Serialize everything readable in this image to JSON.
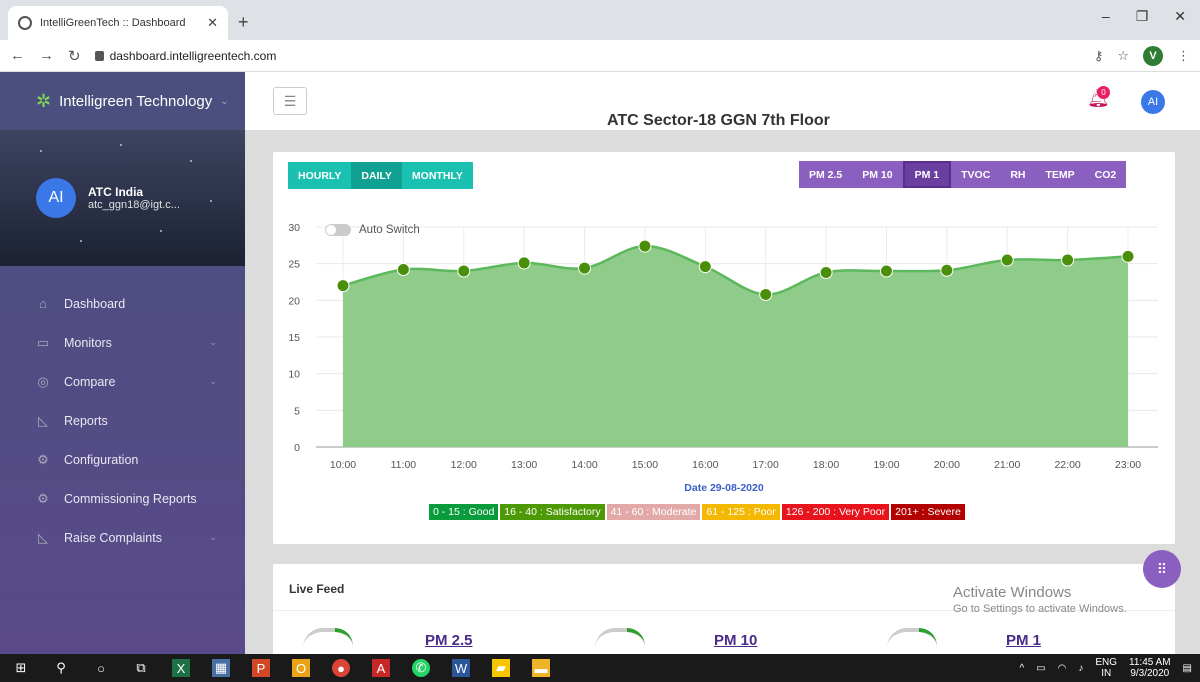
{
  "browser": {
    "tab_title": "IntelliGreenTech :: Dashboard",
    "tab_close": "✕",
    "new_tab": "+",
    "url": "dashboard.intelligreentech.com",
    "profile_initial": "V"
  },
  "sidebar": {
    "brand": "Intelligreen Technology",
    "user_initials": "AI",
    "user_name": "ATC India",
    "user_email": "atc_ggn18@igt.c...",
    "items": [
      {
        "label": "Dashboard",
        "icon": "home-icon",
        "caret": false
      },
      {
        "label": "Monitors",
        "icon": "monitor-icon",
        "caret": true
      },
      {
        "label": "Compare",
        "icon": "compare-icon",
        "caret": true
      },
      {
        "label": "Reports",
        "icon": "reports-icon",
        "caret": false
      },
      {
        "label": "Configuration",
        "icon": "config-icon",
        "caret": false
      },
      {
        "label": "Commissioning Reports",
        "icon": "commissioning-icon",
        "caret": false
      },
      {
        "label": "Raise Complaints",
        "icon": "complaints-icon",
        "caret": true
      }
    ]
  },
  "header": {
    "title": "ATC Sector-18 GGN 7th Floor",
    "notification_count": "0",
    "avatar_initials": "AI"
  },
  "time_buttons": [
    "HOURLY",
    "DAILY",
    "MONTHLY"
  ],
  "time_active": "DAILY",
  "param_buttons": [
    "PM 2.5",
    "PM 10",
    "PM 1",
    "TVOC",
    "RH",
    "TEMP",
    "CO2"
  ],
  "param_active": "PM 1",
  "auto_switch_label": "Auto Switch",
  "date_label": "Date 29-08-2020",
  "legend": [
    {
      "label": "0 - 15 : Good",
      "color": "#0a9b3c"
    },
    {
      "label": "16 - 40 : Satisfactory",
      "color": "#4e9a06"
    },
    {
      "label": "41 - 60 : Moderate",
      "color": "#e3a9a9"
    },
    {
      "label": "61 - 125 : Poor",
      "color": "#f5b800"
    },
    {
      "label": "126 - 200 : Very Poor",
      "color": "#e8141d"
    },
    {
      "label": "201+ : Severe",
      "color": "#b30000"
    }
  ],
  "chart_data": {
    "type": "area",
    "x": [
      "10:00",
      "11:00",
      "12:00",
      "13:00",
      "14:00",
      "15:00",
      "16:00",
      "17:00",
      "18:00",
      "19:00",
      "20:00",
      "21:00",
      "22:00",
      "23:00"
    ],
    "values": [
      22,
      24.2,
      24,
      25.1,
      24.4,
      27.4,
      24.6,
      20.8,
      23.8,
      24,
      24.1,
      25.5,
      25.5,
      26
    ],
    "ylim": [
      0,
      30
    ],
    "yticks": [
      0,
      5,
      10,
      15,
      20,
      25,
      30
    ],
    "grid": true,
    "colors": {
      "fill": "#8fcc8a",
      "line": "#5cb85c",
      "point": "#4a8f0a"
    }
  },
  "live_feed": {
    "title": "Live Feed",
    "items": [
      "PM 2.5",
      "PM 10",
      "PM 1"
    ]
  },
  "watermark": {
    "line1": "Activate Windows",
    "line2": "Go to Settings to activate Windows."
  },
  "taskbar": {
    "lang": "ENG",
    "region": "IN",
    "time": "11:45 AM",
    "date": "9/3/2020"
  }
}
